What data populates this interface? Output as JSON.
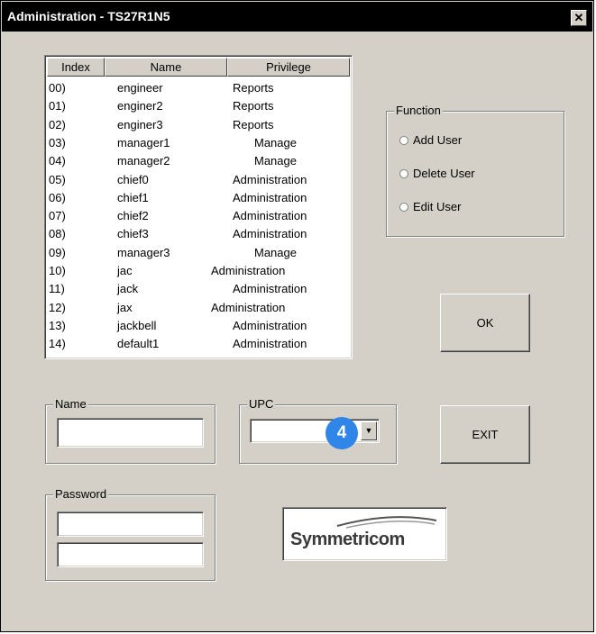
{
  "window": {
    "title": "Administration - TS27R1N5",
    "close_glyph": "✕"
  },
  "user_list": {
    "headers": {
      "index": "Index",
      "name": "Name",
      "privilege": "Privilege"
    },
    "rows": [
      {
        "index": "00)",
        "name": "engineer",
        "privilege": "Reports"
      },
      {
        "index": "01)",
        "name": "enginer2",
        "privilege": "Reports"
      },
      {
        "index": "02)",
        "name": "enginer3",
        "privilege": "Reports"
      },
      {
        "index": "03)",
        "name": "manager1",
        "privilege": "Manage"
      },
      {
        "index": "04)",
        "name": "manager2",
        "privilege": "Manage"
      },
      {
        "index": "05)",
        "name": "chief0",
        "privilege": "Administration"
      },
      {
        "index": "06)",
        "name": "chief1",
        "privilege": "Administration"
      },
      {
        "index": "07)",
        "name": "chief2",
        "privilege": "Administration"
      },
      {
        "index": "08)",
        "name": "chief3",
        "privilege": "Administration"
      },
      {
        "index": "09)",
        "name": "manager3",
        "privilege": "Manage"
      },
      {
        "index": "10)",
        "name": "jac",
        "privilege": "Administration"
      },
      {
        "index": "11)",
        "name": "jack",
        "privilege": "Administration"
      },
      {
        "index": "12)",
        "name": "jax",
        "privilege": "Administration"
      },
      {
        "index": "13)",
        "name": "jackbell",
        "privilege": "Administration"
      },
      {
        "index": "14)",
        "name": "default1",
        "privilege": "Administration"
      }
    ]
  },
  "function_group": {
    "label": "Function",
    "options": [
      "Add User",
      "Delete User",
      "Edit User"
    ]
  },
  "buttons": {
    "ok": "OK",
    "exit": "EXIT"
  },
  "name_group": {
    "label": "Name",
    "value": ""
  },
  "upc_group": {
    "label": "UPC",
    "value": "",
    "arrow_icon": "triangle-down"
  },
  "password_group": {
    "label": "Password",
    "value1": "",
    "value2": ""
  },
  "badge": {
    "number": "4",
    "color": "#2f86e8"
  },
  "logo": {
    "text": "Symmetricom"
  }
}
